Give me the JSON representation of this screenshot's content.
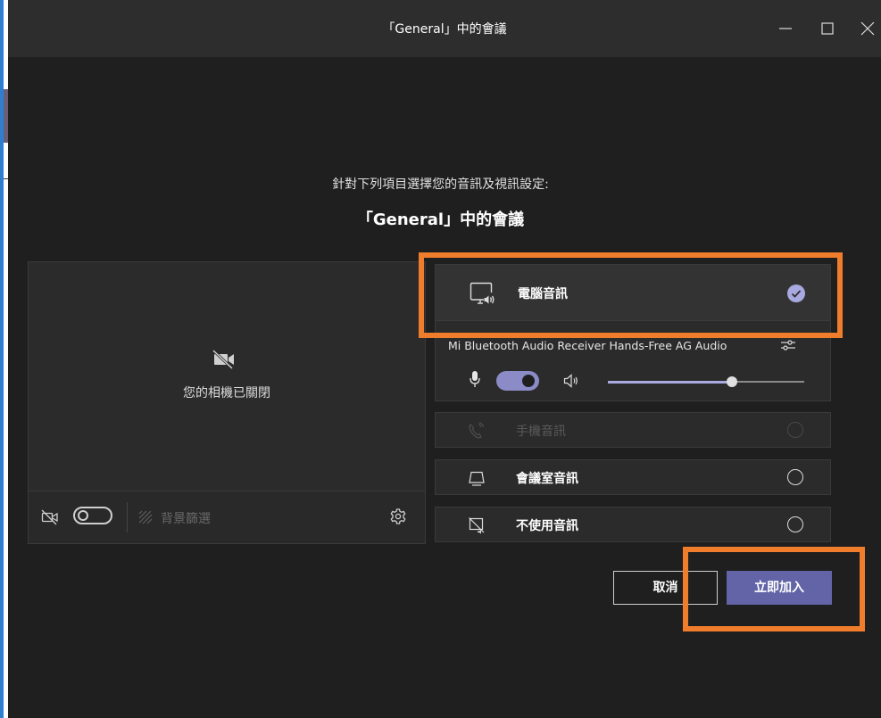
{
  "window": {
    "title": "「General」中的會議"
  },
  "heading": {
    "subtitle": "針對下列項目選擇您的音訊及視訊設定:",
    "title": "「General」中的會議"
  },
  "video": {
    "camera_off_text": "您的相機已關閉",
    "camera_toggle_on": false,
    "background_filter_label": "背景篩選"
  },
  "audio": {
    "computer_audio": {
      "label": "電腦音訊",
      "selected": true
    },
    "device_name": "Mi Bluetooth Audio Receiver Hands-Free AG Audio",
    "mic_toggle_on": true,
    "speaker_volume": 0.63,
    "phone_audio": {
      "label": "手機音訊",
      "disabled": true
    },
    "room_audio": {
      "label": "會議室音訊"
    },
    "no_audio": {
      "label": "不使用音訊"
    }
  },
  "actions": {
    "cancel_label": "取消",
    "join_label": "立即加入"
  },
  "colors": {
    "accent": "#6264a7",
    "toggle_on": "#8b8cc7",
    "highlight": "#ef7d2c",
    "background": "#1f1f1f"
  },
  "icons": {
    "close": "close-icon",
    "minimize": "minimize-icon",
    "maximize": "maximize-icon",
    "camera_off": "camera-off-icon",
    "settings": "gear-icon",
    "computer_audio": "computer-audio-icon",
    "check": "check-icon",
    "equalizer": "equalizer-icon",
    "microphone": "microphone-icon",
    "speaker": "speaker-icon",
    "phone": "phone-icon",
    "room": "room-audio-icon",
    "no_audio": "no-audio-icon",
    "background_filter": "background-filter-icon"
  }
}
